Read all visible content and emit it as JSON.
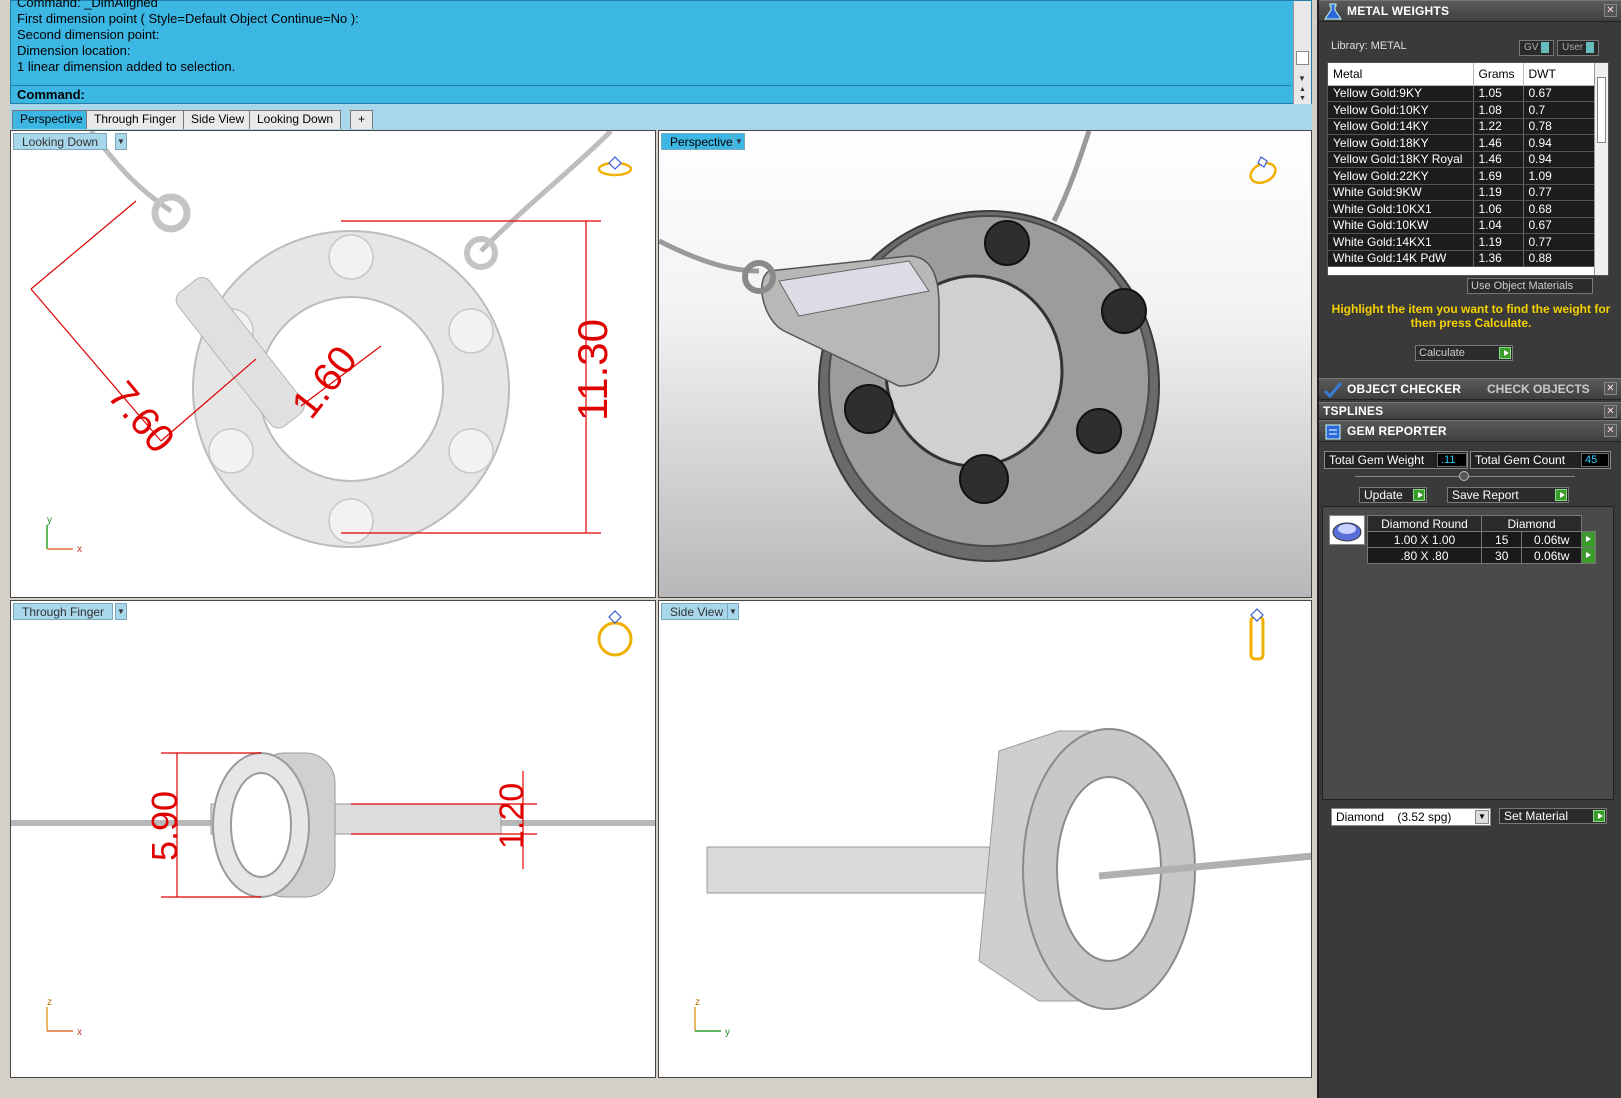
{
  "command": {
    "history": [
      "Command: _DimAligned",
      "First dimension point ( Style=Default  Object  Continue=No ):",
      "Second dimension point:",
      "Dimension location:",
      "1 linear dimension added to selection."
    ],
    "prompt": "Command:"
  },
  "tabs": [
    "Perspective",
    "Through Finger",
    "Side View",
    "Looking Down",
    "+"
  ],
  "viewports": {
    "top_left": {
      "label": "Looking Down",
      "dims": [
        "7.60",
        "1.60",
        "11.30"
      ],
      "axes": {
        "v": "y",
        "h": "x"
      }
    },
    "top_right": {
      "label": "Perspective"
    },
    "bottom_left": {
      "label": "Through Finger",
      "dims": [
        "5.90",
        "1.20"
      ],
      "axes": {
        "v": "z",
        "h": "x"
      }
    },
    "bottom_right": {
      "label": "Side View",
      "axes": {
        "v": "z",
        "h": "y"
      }
    }
  },
  "metal_weights": {
    "title": "METAL WEIGHTS",
    "library": "Library: METAL",
    "gv": "GV",
    "user": "User",
    "columns": [
      "Metal",
      "Grams",
      "DWT"
    ],
    "rows": [
      [
        "Yellow Gold:9KY",
        "1.05",
        "0.67"
      ],
      [
        "Yellow Gold:10KY",
        "1.08",
        "0.7"
      ],
      [
        "Yellow Gold:14KY",
        "1.22",
        "0.78"
      ],
      [
        "Yellow Gold:18KY",
        "1.46",
        "0.94"
      ],
      [
        "Yellow Gold:18KY Royal",
        "1.46",
        "0.94"
      ],
      [
        "Yellow Gold:22KY",
        "1.69",
        "1.09"
      ],
      [
        "White Gold:9KW",
        "1.19",
        "0.77"
      ],
      [
        "White Gold:10KX1",
        "1.06",
        "0.68"
      ],
      [
        "White Gold:10KW",
        "1.04",
        "0.67"
      ],
      [
        "White Gold:14KX1",
        "1.19",
        "0.77"
      ],
      [
        "White Gold:14K PdW",
        "1.36",
        "0.88"
      ]
    ],
    "use_object_materials": "Use Object Materials",
    "hint": "Highlight the item you want to find the weight for then press Calculate.",
    "calculate": "Calculate"
  },
  "object_checker": {
    "title": "OBJECT CHECKER",
    "tab2": "CHECK OBJECTS"
  },
  "tsplines": {
    "title": "TSPLINES"
  },
  "gem_reporter": {
    "title": "GEM REPORTER",
    "total_weight_label": "Total Gem Weight",
    "total_weight": ".11",
    "total_count_label": "Total Gem Count",
    "total_count": "45",
    "update": "Update",
    "save_report": "Save Report",
    "table_headers": [
      "Diamond Round",
      "Diamond"
    ],
    "rows": [
      [
        "1.00 X 1.00",
        "15",
        "0.06tw"
      ],
      [
        ".80 X .80",
        "30",
        "0.06tw"
      ]
    ],
    "material": "Diamond    (3.52 spg)",
    "set_material": "Set Material"
  }
}
